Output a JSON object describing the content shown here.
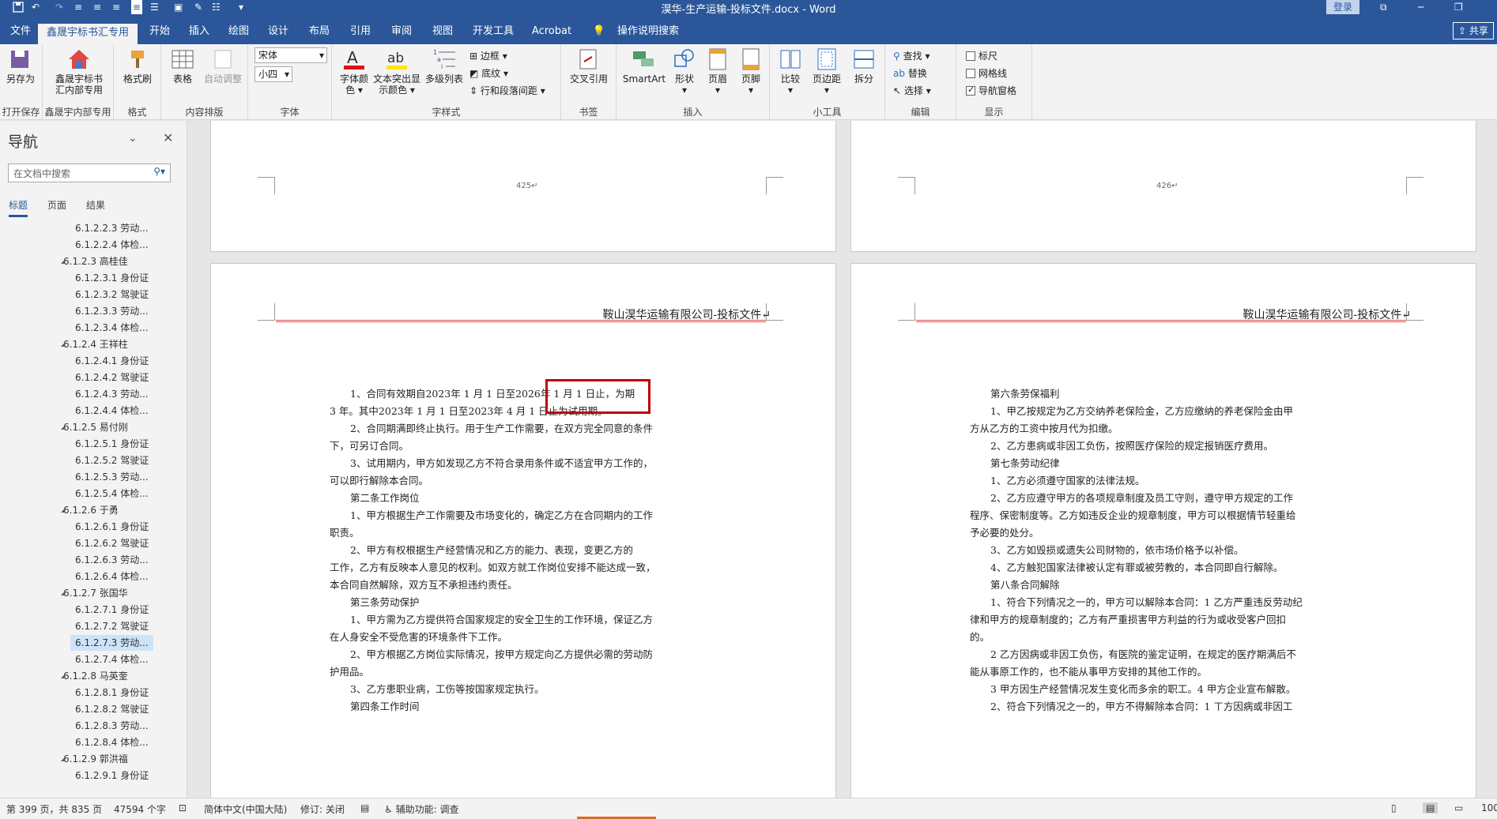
{
  "titlebar": {
    "title": "淏华-生产运输-投标文件.docx  -  Word",
    "login": "登录"
  },
  "tabs": [
    "文件",
    "鑫晟宇标书汇专用",
    "开始",
    "插入",
    "绘图",
    "设计",
    "布局",
    "引用",
    "审阅",
    "视图",
    "开发工具",
    "Acrobat",
    "操作说明搜索"
  ],
  "share": "共享",
  "ribbon": {
    "groups": {
      "save": {
        "btn1": "另存为",
        "label": "打开保存"
      },
      "xsy": {
        "btn1": "鑫晟宇标书",
        "btn1b": "汇内部专用",
        "label": "鑫晟宇内部专用"
      },
      "format": {
        "btn1": "格式刷",
        "label": "格式"
      },
      "layout": {
        "btn1": "表格",
        "btn2": "自动调整",
        "label": "内容排版"
      },
      "font": {
        "name": "宋体",
        "size": "小四",
        "label": "字体"
      },
      "style": {
        "b1": "字体颜",
        "b1b": "色",
        "b2": "文本突出显",
        "b2b": "示颜色",
        "b3": "多级列表",
        "s1": "边框",
        "s2": "底纹",
        "s3": "行和段落间距",
        "label": "字样式"
      },
      "bookmark": {
        "b1": "交叉引用",
        "label": "书签"
      },
      "insert": {
        "b1": "SmartArt",
        "b2": "形状",
        "b3": "页眉",
        "b4": "页脚",
        "label": "插入"
      },
      "tools": {
        "b1": "比较",
        "b2": "页边距",
        "b3": "拆分",
        "label": "小工具"
      },
      "edit": {
        "s1": "查找",
        "s2": "替换",
        "s3": "选择",
        "label": "编辑"
      },
      "show": {
        "s1": "标尺",
        "s2": "网格线",
        "s3": "导航窗格",
        "label": "显示"
      }
    }
  },
  "nav": {
    "title": "导航",
    "search_placeholder": "在文档中搜索",
    "tabs": [
      "标题",
      "页面",
      "结果"
    ],
    "items": [
      {
        "text": "6.1.2.2.3 劳动...",
        "level": 2
      },
      {
        "text": "6.1.2.2.4 体检...",
        "level": 2
      },
      {
        "text": "6.1.2.3 高桂佳",
        "level": 1
      },
      {
        "text": "6.1.2.3.1 身份证",
        "level": 2
      },
      {
        "text": "6.1.2.3.2 驾驶证",
        "level": 2
      },
      {
        "text": "6.1.2.3.3 劳动...",
        "level": 2
      },
      {
        "text": "6.1.2.3.4 体检...",
        "level": 2
      },
      {
        "text": "6.1.2.4 王祥柱",
        "level": 1
      },
      {
        "text": "6.1.2.4.1 身份证",
        "level": 2
      },
      {
        "text": "6.1.2.4.2 驾驶证",
        "level": 2
      },
      {
        "text": "6.1.2.4.3 劳动...",
        "level": 2
      },
      {
        "text": "6.1.2.4.4 体检...",
        "level": 2
      },
      {
        "text": "6.1.2.5 易付刚",
        "level": 1
      },
      {
        "text": "6.1.2.5.1 身份证",
        "level": 2
      },
      {
        "text": "6.1.2.5.2 驾驶证",
        "level": 2
      },
      {
        "text": "6.1.2.5.3 劳动...",
        "level": 2
      },
      {
        "text": "6.1.2.5.4 体检...",
        "level": 2
      },
      {
        "text": "6.1.2.6 于勇",
        "level": 1
      },
      {
        "text": "6.1.2.6.1 身份证",
        "level": 2
      },
      {
        "text": "6.1.2.6.2 驾驶证",
        "level": 2
      },
      {
        "text": "6.1.2.6.3 劳动...",
        "level": 2
      },
      {
        "text": "6.1.2.6.4 体检...",
        "level": 2
      },
      {
        "text": "6.1.2.7 张国华",
        "level": 1
      },
      {
        "text": "6.1.2.7.1 身份证",
        "level": 2
      },
      {
        "text": "6.1.2.7.2 驾驶证",
        "level": 2
      },
      {
        "text": "6.1.2.7.3 劳动...",
        "level": 2,
        "selected": true
      },
      {
        "text": "6.1.2.7.4 体检...",
        "level": 2
      },
      {
        "text": "6.1.2.8 马英奎",
        "level": 1
      },
      {
        "text": "6.1.2.8.1 身份证",
        "level": 2
      },
      {
        "text": "6.1.2.8.2 驾驶证",
        "level": 2
      },
      {
        "text": "6.1.2.8.3 劳动...",
        "level": 2
      },
      {
        "text": "6.1.2.8.4 体检...",
        "level": 2
      },
      {
        "text": "6.1.2.9 郭洪福",
        "level": 1
      },
      {
        "text": "6.1.2.9.1 身份证",
        "level": 2
      }
    ]
  },
  "pages": {
    "top_left_num": "425↵",
    "top_right_num": "426↵",
    "header": "鞍山淏华运输有限公司-投标文件↵",
    "left_lines": [
      "1、合同有效期自2023年 1 月 1 日至2026年 1 月 1 日止，为期",
      "3 年。其中2023年 1 月 1 日至2023年 4 月 1 日止为试用期。",
      "2、合同期满即终止执行。用于生产工作需要，在双方完全同意的条件",
      "下，可另订合同。",
      "3、试用期内，甲方如发现乙方不符合录用条件或不适宜甲方工作的，",
      "可以即行解除本合同。",
      "第二条工作岗位",
      "1、甲方根据生产工作需要及市场变化的，确定乙方在合同期内的工作",
      "职责。",
      "2、甲方有权根据生产经营情况和乙方的能力、表现，变更乙方的",
      "工作，乙方有反映本人意见的权利。如双方就工作岗位安排不能达成一致，",
      "本合同自然解除，双方互不承担违约责任。",
      "第三条劳动保护",
      "1、甲方需为乙方提供符合国家规定的安全卫生的工作环境，保证乙方",
      "在人身安全不受危害的环境条件下工作。",
      "2、甲方根据乙方岗位实际情况，按甲方规定向乙方提供必需的劳动防",
      "护用品。",
      "3、乙方患职业病，工伤等按国家规定执行。",
      "第四条工作时间"
    ],
    "right_lines": [
      "第六条劳保福利",
      "1、甲乙按规定为乙方交纳养老保险金，乙方应缴纳的养老保险金由甲",
      "方从乙方的工资中按月代为扣缴。",
      "2、乙方患病或非因工负伤，按照医疗保险的规定报销医疗费用。",
      "第七条劳动纪律",
      "1、乙方必须遵守国家的法律法规。",
      "2、乙方应遵守甲方的各项规章制度及员工守则，遵守甲方规定的工作",
      "程序、保密制度等。乙方如违反企业的规章制度，甲方可以根据情节轻重给",
      "予必要的处分。",
      "3、乙方如毁损或遗失公司财物的，依市场价格予以补偿。",
      "4、乙方触犯国家法律被认定有罪或被劳教的，本合同即自行解除。",
      "第八条合同解除",
      "1、符合下列情况之一的，甲方可以解除本合同：1 乙方严重违反劳动纪",
      "律和甲方的规章制度的；乙方有严重损害甲方利益的行为或收受客户回扣",
      "的。",
      "2 乙方因病或非因工负伤，有医院的鉴定证明，在规定的医疗期满后不",
      "能从事原工作的，也不能从事甲方安排的其他工作的。",
      "3 甲方因生产经营情况发生变化而多余的职工。4 甲方企业宣布解散。",
      "2、符合下列情况之一的，甲方不得解除本合同：1 ㄒ方因病或非因工"
    ]
  },
  "status": {
    "page": "第 399 页，共 835 页",
    "words": "47594 个字",
    "lang": "简体中文(中国大陆)",
    "track": "修订: 关闭",
    "access": "辅助功能: 调查",
    "zoom": "100"
  }
}
